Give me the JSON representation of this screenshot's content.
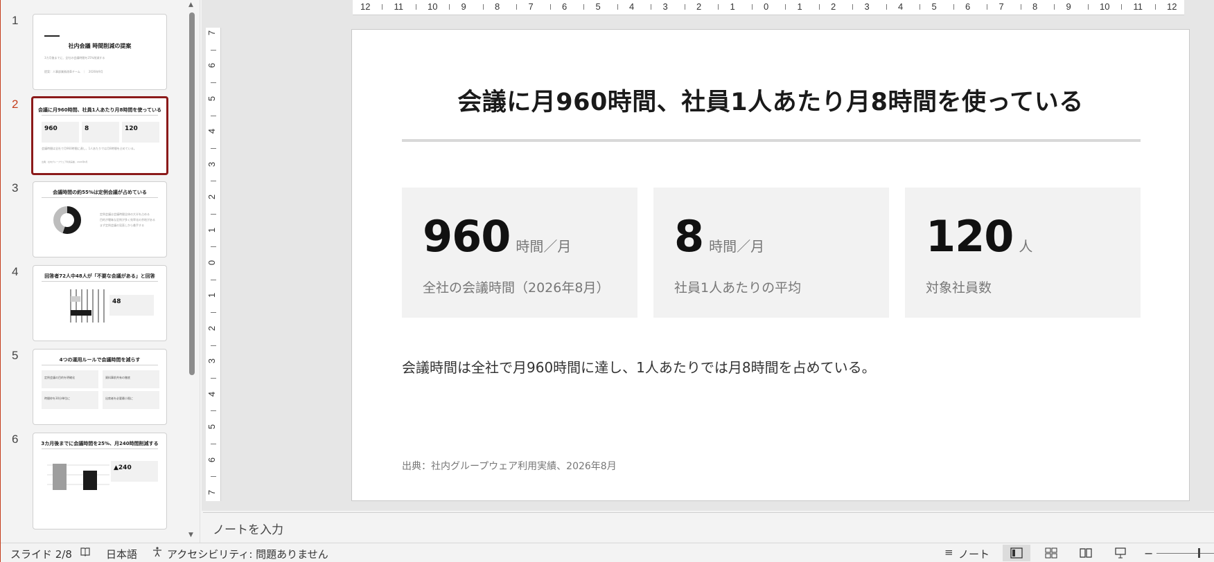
{
  "thumbnails": [
    {
      "num": "1",
      "title": "社内会議 時間削減の提案",
      "sub": "3カ月後までに、全社の会議時間を25%削減する",
      "meta": "提案：人事部業務改革チーム　｜　2026年9月"
    },
    {
      "num": "2",
      "title": "会議に月960時間、社員1人あたり月8時間を使っている",
      "boxes": [
        "960",
        "8",
        "120"
      ],
      "note": "会議時間は全社で月960時間に達し、1人あたりでは月8時間を占めている。",
      "src": "出典：社内グループウェア利用実績、2026年8月"
    },
    {
      "num": "3",
      "title": "会議時間の約55%は定例会議が占めている",
      "bullets": [
        "定例会議は会議時間全体の大半を占める",
        "目的が曖昧な定例が多く効率化の余地がある",
        "まず定例会議の見直しから着手する"
      ]
    },
    {
      "num": "4",
      "title": "回答者72人中48人が「不要な会議がある」と回答",
      "stat": "48"
    },
    {
      "num": "5",
      "title": "4つの運用ルールで会議時間を減らす",
      "items": [
        "定例会議の目的を明確化",
        "資料事前共有の徹底",
        "時間枠を30分単位に",
        "出席者を必要最小限に"
      ]
    },
    {
      "num": "6",
      "title": "3カ月後までに会議時間を25%、月240時間削減する",
      "stat": "▲240"
    }
  ],
  "ruler": {
    "h_labels": [
      "12",
      "11",
      "10",
      "9",
      "8",
      "7",
      "6",
      "5",
      "4",
      "3",
      "2",
      "1",
      "0",
      "1",
      "2",
      "3",
      "4",
      "5",
      "6",
      "7",
      "8",
      "9",
      "10",
      "11",
      "12"
    ],
    "v_labels": [
      "7",
      "6",
      "5",
      "4",
      "3",
      "2",
      "1",
      "0",
      "1",
      "2",
      "3",
      "4",
      "5",
      "6",
      "7"
    ]
  },
  "slide": {
    "title": "会議に月960時間、社員1人あたり月8時間を使っている",
    "cards": [
      {
        "value": "960",
        "unit": "時間／月",
        "label": "全社の会議時間（2026年8月）"
      },
      {
        "value": "8",
        "unit": "時間／月",
        "label": "社員1人あたりの平均"
      },
      {
        "value": "120",
        "unit": "人",
        "label": "対象社員数"
      }
    ],
    "body": "会議時間は全社で月960時間に達し、1人あたりでは月8時間を占めている。",
    "source": "出典：社内グループウェア利用実績、2026年8月"
  },
  "notes": {
    "placeholder": "ノートを入力"
  },
  "status": {
    "slide_indicator": "スライド 2/8",
    "language": "日本語",
    "accessibility": "アクセシビリティ: 問題ありません",
    "notes_button": "ノート"
  }
}
